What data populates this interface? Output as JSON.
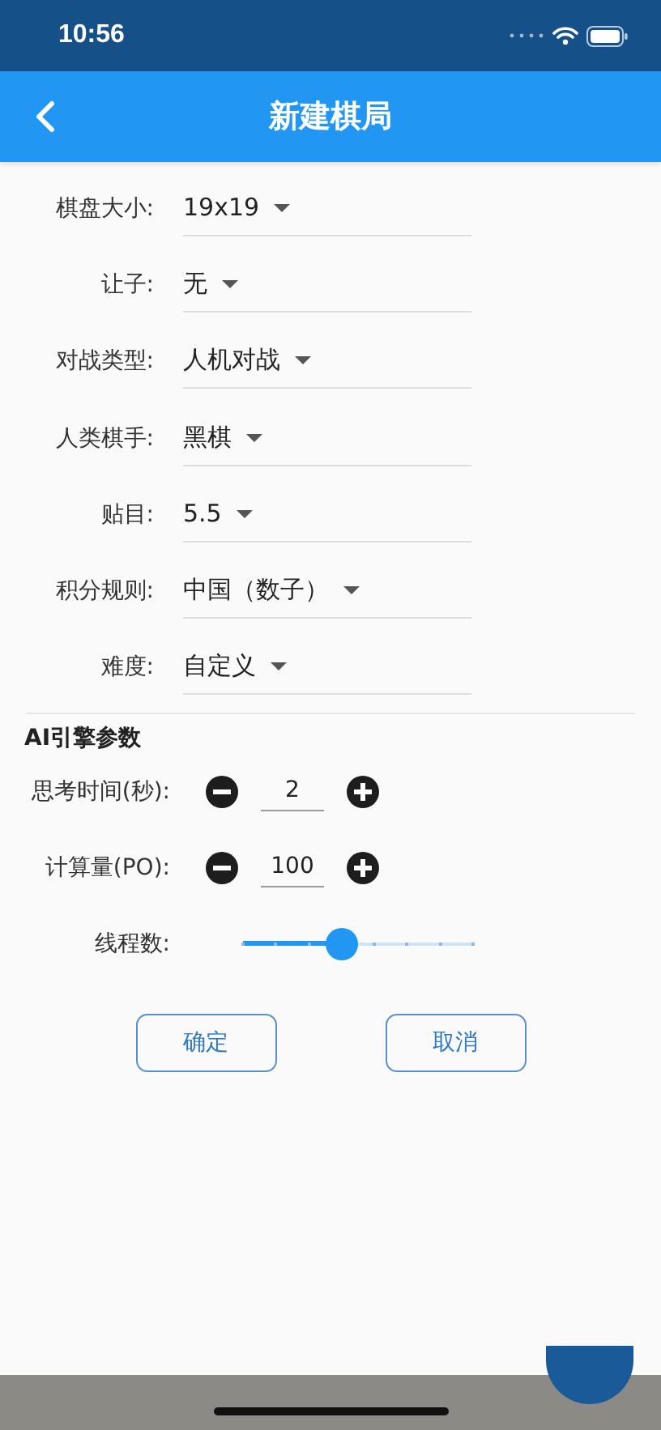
{
  "status_bar": {
    "time": "10:56"
  },
  "app_bar": {
    "title": "新建棋局"
  },
  "form": [
    {
      "label": "棋盘大小:",
      "value": "19x19"
    },
    {
      "label": "让子:",
      "value": "无"
    },
    {
      "label": "对战类型:",
      "value": "人机对战"
    },
    {
      "label": "人类棋手:",
      "value": "黑棋"
    },
    {
      "label": "贴目:",
      "value": "5.5"
    },
    {
      "label": "积分规则:",
      "value": "中国（数子）"
    },
    {
      "label": "难度:",
      "value": "自定义"
    }
  ],
  "ai_section": {
    "title": "AI引擎参数",
    "params": [
      {
        "kind": "stepper",
        "label": "思考时间(秒):",
        "value": "2"
      },
      {
        "kind": "stepper",
        "label": "计算量(PO):",
        "value": "100"
      },
      {
        "kind": "slider",
        "label": "线程数:",
        "level": 0.43
      }
    ]
  },
  "buttons": [
    "确定",
    "取消"
  ]
}
